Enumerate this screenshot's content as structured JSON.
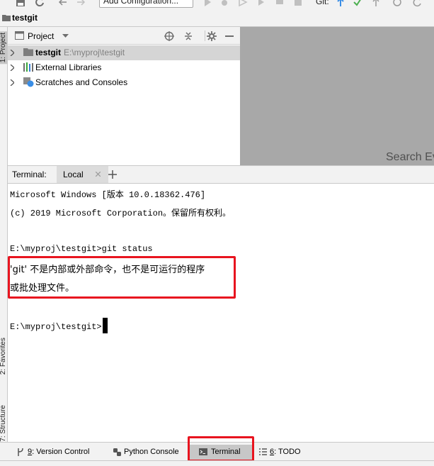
{
  "toolbar": {
    "run_config_label": "Add Configuration...",
    "git_label": "Git:",
    "icons": [
      "save-icon",
      "sync-icon",
      "back-arrow-icon",
      "forward-arrow-icon",
      "run-icon",
      "debug-icon",
      "coverage-icon",
      "profile-icon",
      "build-icon",
      "stop-icon",
      "git-update-icon",
      "git-commit-icon",
      "git-push-icon",
      "history-icon",
      "rollback-icon"
    ]
  },
  "navbar": {
    "project_name": "testgit"
  },
  "left_strip": {
    "tabs": [
      "1: Project",
      "2: Favorites",
      "7: Structure"
    ]
  },
  "project_panel": {
    "title": "Project",
    "tree": [
      {
        "label": "testgit",
        "path": "E:\\myproj\\testgit",
        "icon": "folder-icon",
        "selected": true
      },
      {
        "label": "External Libraries",
        "icon": "library-icon"
      },
      {
        "label": "Scratches and Consoles",
        "icon": "scratches-icon"
      }
    ]
  },
  "editor": {
    "hint": "Search Ev"
  },
  "terminal": {
    "title": "Terminal:",
    "tab_label": "Local",
    "lines": [
      "Microsoft Windows [版本 10.0.18362.476]",
      "(c) 2019 Microsoft Corporation。保留所有权利。",
      "",
      "E:\\myproj\\testgit>git status",
      "'git' 不是内部或外部命令，也不是可运行的程序",
      "或批处理文件。",
      "",
      "E:\\myproj\\testgit>"
    ]
  },
  "bottom_bar": {
    "tabs": [
      {
        "key": "9",
        "label": ": Version Control"
      },
      {
        "key": "",
        "label": "Python Console"
      },
      {
        "key": "",
        "label": "Terminal"
      },
      {
        "key": "6",
        "label": ": TODO"
      }
    ]
  },
  "colors": {
    "highlight_border": "#e8141f",
    "git_update": "#3a8ee6",
    "git_commit": "#4caf50",
    "ide_background": "#f2f2f2"
  }
}
